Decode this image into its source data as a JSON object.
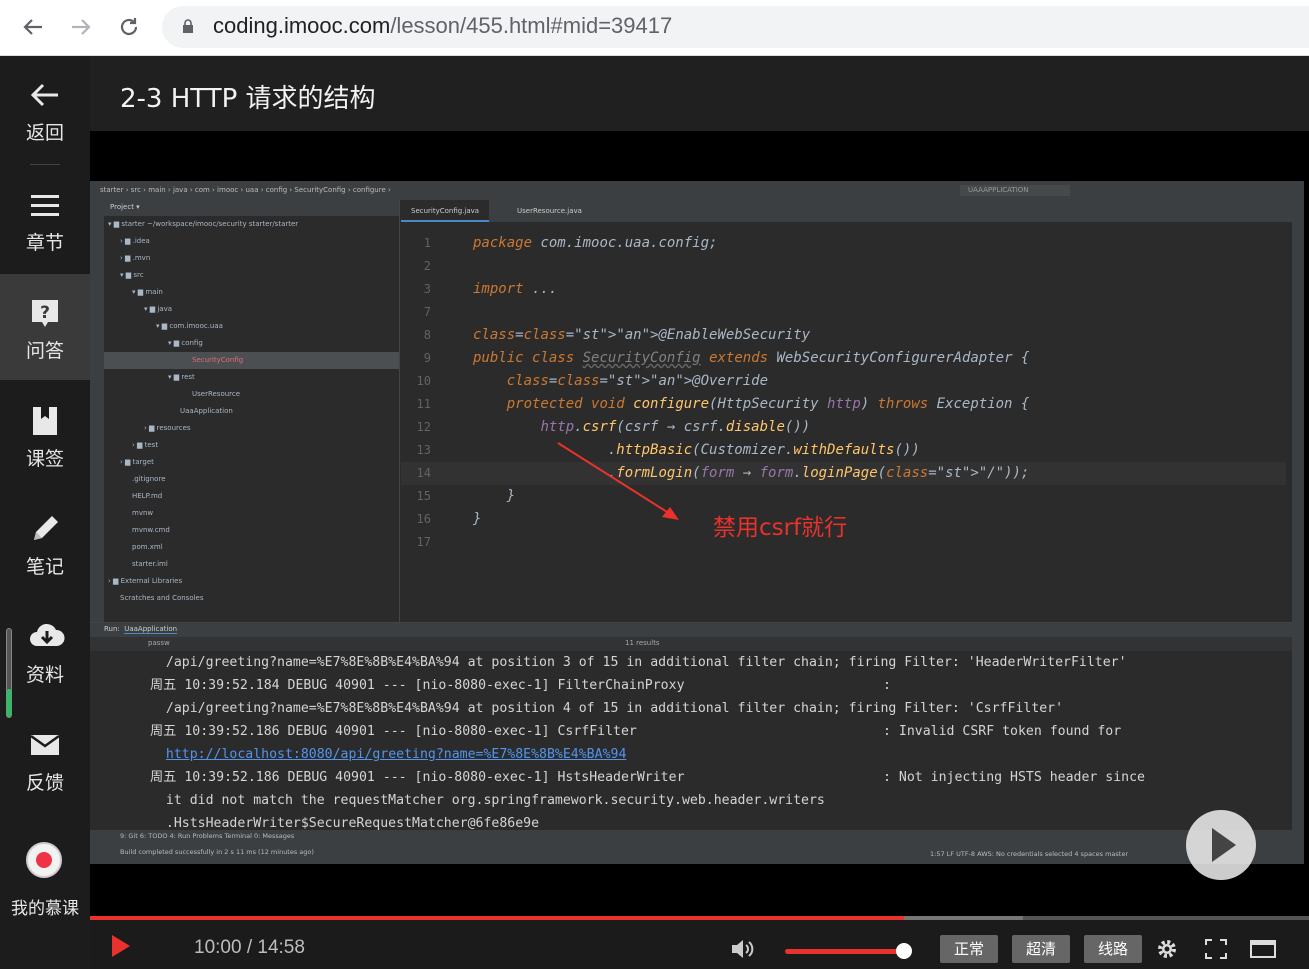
{
  "browser": {
    "url_host": "coding.imooc.com",
    "url_path": "/lesson/455.html#mid=39417"
  },
  "sidebar": {
    "items": [
      {
        "label": "返回",
        "icon": "back-arrow-icon"
      },
      {
        "label": "章节",
        "icon": "menu-icon"
      },
      {
        "label": "问答",
        "icon": "question-icon"
      },
      {
        "label": "课签",
        "icon": "bookmark-icon"
      },
      {
        "label": "笔记",
        "icon": "pencil-icon"
      },
      {
        "label": "资料",
        "icon": "download-cloud-icon"
      },
      {
        "label": "反馈",
        "icon": "mail-icon"
      }
    ],
    "user_label": "我的慕课"
  },
  "lesson": {
    "title": "2-3 HTTP 请求的结构"
  },
  "ide": {
    "breadcrumb": "starter  ›  src  ›  main  ›  java  ›  com  ›  imooc  ›  uaa  ›  config  ›  SecurityConfig  ›  configure  ›",
    "run_config": "UAAAPPLICATION",
    "project_header": "Project ▾",
    "project_tree": [
      {
        "text": "▾ ▆ starter ~/workspace/imooc/security starter/starter",
        "indent": 0,
        "sel": false
      },
      {
        "text": "› ▆ .idea",
        "indent": 1,
        "sel": false
      },
      {
        "text": "› ▆ .mvn",
        "indent": 1,
        "sel": false
      },
      {
        "text": "▾ ▆ src",
        "indent": 1,
        "sel": false
      },
      {
        "text": "▾ ▆ main",
        "indent": 2,
        "sel": false
      },
      {
        "text": "▾ ▆ java",
        "indent": 3,
        "sel": false
      },
      {
        "text": "▾ ▆ com.imooc.uaa",
        "indent": 4,
        "sel": false
      },
      {
        "text": "▾ ▆ config",
        "indent": 5,
        "sel": false
      },
      {
        "text": "SecurityConfig",
        "indent": 7,
        "sel": true
      },
      {
        "text": "▾ ▆ rest",
        "indent": 5,
        "sel": false
      },
      {
        "text": "UserResource",
        "indent": 7,
        "sel": false
      },
      {
        "text": "UaaApplication",
        "indent": 6,
        "sel": false
      },
      {
        "text": "› ▆ resources",
        "indent": 3,
        "sel": false
      },
      {
        "text": "› ▆ test",
        "indent": 2,
        "sel": false
      },
      {
        "text": "› ▆ target",
        "indent": 1,
        "sel": false
      },
      {
        "text": ".gitignore",
        "indent": 2,
        "sel": false
      },
      {
        "text": "HELP.md",
        "indent": 2,
        "sel": false
      },
      {
        "text": "mvnw",
        "indent": 2,
        "sel": false
      },
      {
        "text": "mvnw.cmd",
        "indent": 2,
        "sel": false
      },
      {
        "text": "pom.xml",
        "indent": 2,
        "sel": false
      },
      {
        "text": "starter.iml",
        "indent": 2,
        "sel": false
      },
      {
        "text": "› ▆ External Libraries",
        "indent": 0,
        "sel": false
      },
      {
        "text": "Scratches and Consoles",
        "indent": 1,
        "sel": false
      }
    ],
    "tabs": [
      "SecurityConfig.java",
      "UserResource.java"
    ],
    "annotation": "禁用csrf就行",
    "run_tab": "UaaApplication",
    "run_label": "Run:",
    "filter_text": "passw",
    "results": "11 results",
    "status_left": "Build completed successfully in 2 s 11 ms (12 minutes ago)",
    "status_right": "1:57   LF   UTF-8   AWS: No credentials selected   4 spaces   master",
    "bottom_tabs": "9: Git    6: TODO    4: Run    Problems    Terminal    0: Messages"
  },
  "code_lines": [
    {
      "n": "1",
      "code": "package com.imooc.uaa.config;"
    },
    {
      "n": "2",
      "code": ""
    },
    {
      "n": "3",
      "code": "import ..."
    },
    {
      "n": "7",
      "code": ""
    },
    {
      "n": "8",
      "code": "@EnableWebSecurity"
    },
    {
      "n": "9",
      "code": "public class SecurityConfig extends WebSecurityConfigurerAdapter {"
    },
    {
      "n": "10",
      "code": "    @Override"
    },
    {
      "n": "11",
      "code": "    protected void configure(HttpSecurity http) throws Exception {"
    },
    {
      "n": "12",
      "code": "        http.csrf(csrf → csrf.disable())"
    },
    {
      "n": "13",
      "code": "                .httpBasic(Customizer.withDefaults())"
    },
    {
      "n": "14",
      "code": "                .formLogin(form → form.loginPage(\"/\"));"
    },
    {
      "n": "15",
      "code": "    }"
    },
    {
      "n": "16",
      "code": "}"
    },
    {
      "n": "17",
      "code": ""
    }
  ],
  "log_lines": [
    "  /api/greeting?name=%E7%8E%8B%E4%BA%94 at position 3 of 15 in additional filter chain; firing Filter: 'HeaderWriterFilter'",
    "周五 10:39:52.184 DEBUG 40901 --- [nio-8080-exec-1] FilterChainProxy                         :",
    "  /api/greeting?name=%E7%8E%8B%E4%BA%94 at position 4 of 15 in additional filter chain; firing Filter: 'CsrfFilter'",
    "周五 10:39:52.186 DEBUG 40901 --- [nio-8080-exec-1] CsrfFilter                               : Invalid CSRF token found for",
    "  http://localhost:8080/api/greeting?name=%E7%8E%8B%E4%BA%94",
    "周五 10:39:52.186 DEBUG 40901 --- [nio-8080-exec-1] HstsHeaderWriter                         : Not injecting HSTS header since",
    "  it did not match the requestMatcher org.springframework.security.web.header.writers",
    "  .HstsHeaderWriter$SecureRequestMatcher@6fe86e9e"
  ],
  "player": {
    "time": "10:00 / 14:58",
    "progress_fraction": 0.668,
    "buffered_fraction": 0.765,
    "volume_fraction": 1.0,
    "quality": [
      "正常",
      "超清",
      "线路"
    ]
  },
  "colors": {
    "accent": "#e8322b",
    "sidebar_bg": "#1c1c1c",
    "active_item_bg": "#3a3a3a"
  }
}
